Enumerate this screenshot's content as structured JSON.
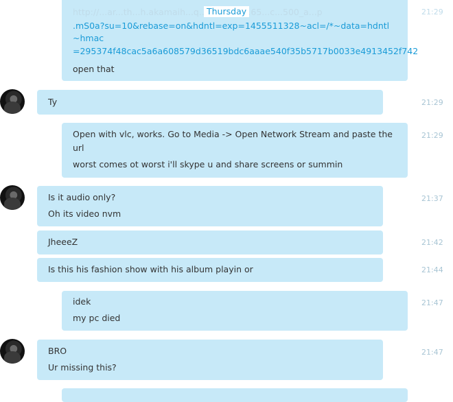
{
  "day_separator": "Thursday",
  "messages": [
    {
      "lines": [
        "http://...ar...th...h.akamaih...q...4...01..7...65...c...500_a...p",
        ".mS0a?su=10&rebase=on&hdntl=exp=1455511328~acl=/*~data=hdntl",
        "~hmac",
        "=295374f48cac5a6a608579d36519bdc6aaae540f35b5717b0033e4913452f742",
        "open that"
      ],
      "time": "21:29"
    },
    {
      "lines": [
        "Ty"
      ],
      "time": "21:29"
    },
    {
      "lines": [
        "Open with vlc, works. Go to Media -> Open Network Stream and paste the",
        "url",
        "worst comes ot worst i'll skype u and share screens or summin"
      ],
      "time": "21:29"
    },
    {
      "lines": [
        "Is it audio only?",
        "Oh its video nvm"
      ],
      "time": "21:37"
    },
    {
      "lines": [
        "JheeeZ"
      ],
      "time": "21:42"
    },
    {
      "lines": [
        "Is this his fashion show with his album playin or"
      ],
      "time": "21:44"
    },
    {
      "lines": [
        "idek",
        "my pc died"
      ],
      "time": "21:47"
    },
    {
      "lines": [
        "BRO",
        "Ur missing this?"
      ],
      "time": "21:47"
    }
  ],
  "colors": {
    "bubble": "#c7e9f8",
    "link": "#1a9bd7",
    "timestamp": "#a8c5d4",
    "day_separator": "#1a9bd7"
  },
  "icons": {
    "avatar": "user-avatar-photo"
  }
}
